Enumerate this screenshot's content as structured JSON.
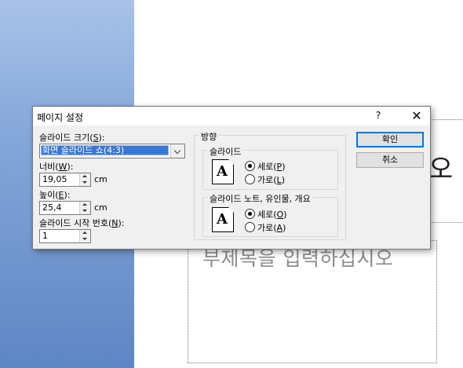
{
  "slide": {
    "title_fragment": "오",
    "subtitle_placeholder": "부제목을 입력하십시오"
  },
  "dialog": {
    "title": "페이지 설정",
    "help": "?",
    "close": "✕",
    "size_label_pre": "슬라이드 크기(",
    "size_label_key": "S",
    "size_label_post": "):",
    "size_value": "화면 슬라이드 쇼(4:3)",
    "width_label_pre": "너비(",
    "width_label_key": "W",
    "width_label_post": "):",
    "width_value": "19,05",
    "width_unit": "cm",
    "height_label_pre": "높이(",
    "height_label_key": "E",
    "height_label_post": "):",
    "height_value": "25,4",
    "height_unit": "cm",
    "start_label_pre": "슬라이드 시작 번호(",
    "start_label_key": "N",
    "start_label_post": "):",
    "start_value": "1",
    "orientation_label": "방향",
    "slides_group": "슬라이드",
    "slides_portrait_pre": "세로(",
    "slides_portrait_key": "P",
    "slides_landscape_pre": "가로(",
    "slides_landscape_key": "L",
    "notes_group": "슬라이드 노트, 유인물, 개요",
    "notes_portrait_pre": "세로(",
    "notes_portrait_key": "O",
    "notes_landscape_pre": "가로(",
    "notes_landscape_key": "A",
    "paren_close": ")",
    "page_glyph": "A",
    "ok": "확인",
    "cancel": "취소"
  }
}
